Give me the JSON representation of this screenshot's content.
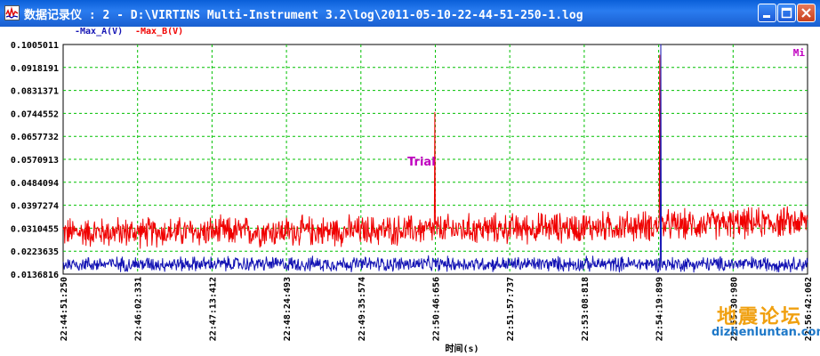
{
  "window": {
    "title": "数据记录仪 : 2 - D:\\VIRTINS Multi-Instrument 3.2\\log\\2011-05-10-22-44-51-250-1.log",
    "colors": {
      "titlebar": "#1a5fd0",
      "title_text": "#ffffff"
    }
  },
  "legend": [
    {
      "label": "-Max_A(V)",
      "color": "#1414b4"
    },
    {
      "label": "-Max_B(V)",
      "color": "#f00000"
    }
  ],
  "chart_data": {
    "type": "line",
    "xlabel": "时间(s)",
    "ylabel": "",
    "x_ticks": [
      "22:44:51:250",
      "22:46:02:331",
      "22:47:13:412",
      "22:48:24:493",
      "22:49:35:574",
      "22:50:46:656",
      "22:51:57:737",
      "22:53:08:818",
      "22:54:19:899",
      "22:55:30:980",
      "22:56:42:062"
    ],
    "y_ticks": [
      "0.1005011",
      "0.0918191",
      "0.0831371",
      "0.0744552",
      "0.0657732",
      "0.0570913",
      "0.0484094",
      "0.0397274",
      "0.0310455",
      "0.0223635",
      "0.0136816"
    ],
    "ylim": [
      0.0136816,
      0.1005011
    ],
    "grid": true,
    "grid_color": "#00c000",
    "series": [
      {
        "name": "Max_A(V)",
        "color": "#1414b4",
        "baseline": 0.0175,
        "noise": 0.0022,
        "spikes": [
          {
            "x": "22:54:22",
            "value": 0.1005011
          }
        ]
      },
      {
        "name": "Max_B(V)",
        "color": "#f00000",
        "baseline_start": 0.0295,
        "baseline_end": 0.0335,
        "noise": 0.0045,
        "spikes": [
          {
            "x": "22:50:46",
            "value": 0.0748
          },
          {
            "x": "22:54:21",
            "value": 0.0965
          }
        ]
      }
    ],
    "annotations": [
      {
        "text": "Trial",
        "color": "#c000c0"
      },
      {
        "text": "Mi",
        "color": "#c000c0"
      }
    ]
  },
  "watermark": {
    "cn": "地震论坛",
    "url": "dizhenluntan.com"
  }
}
